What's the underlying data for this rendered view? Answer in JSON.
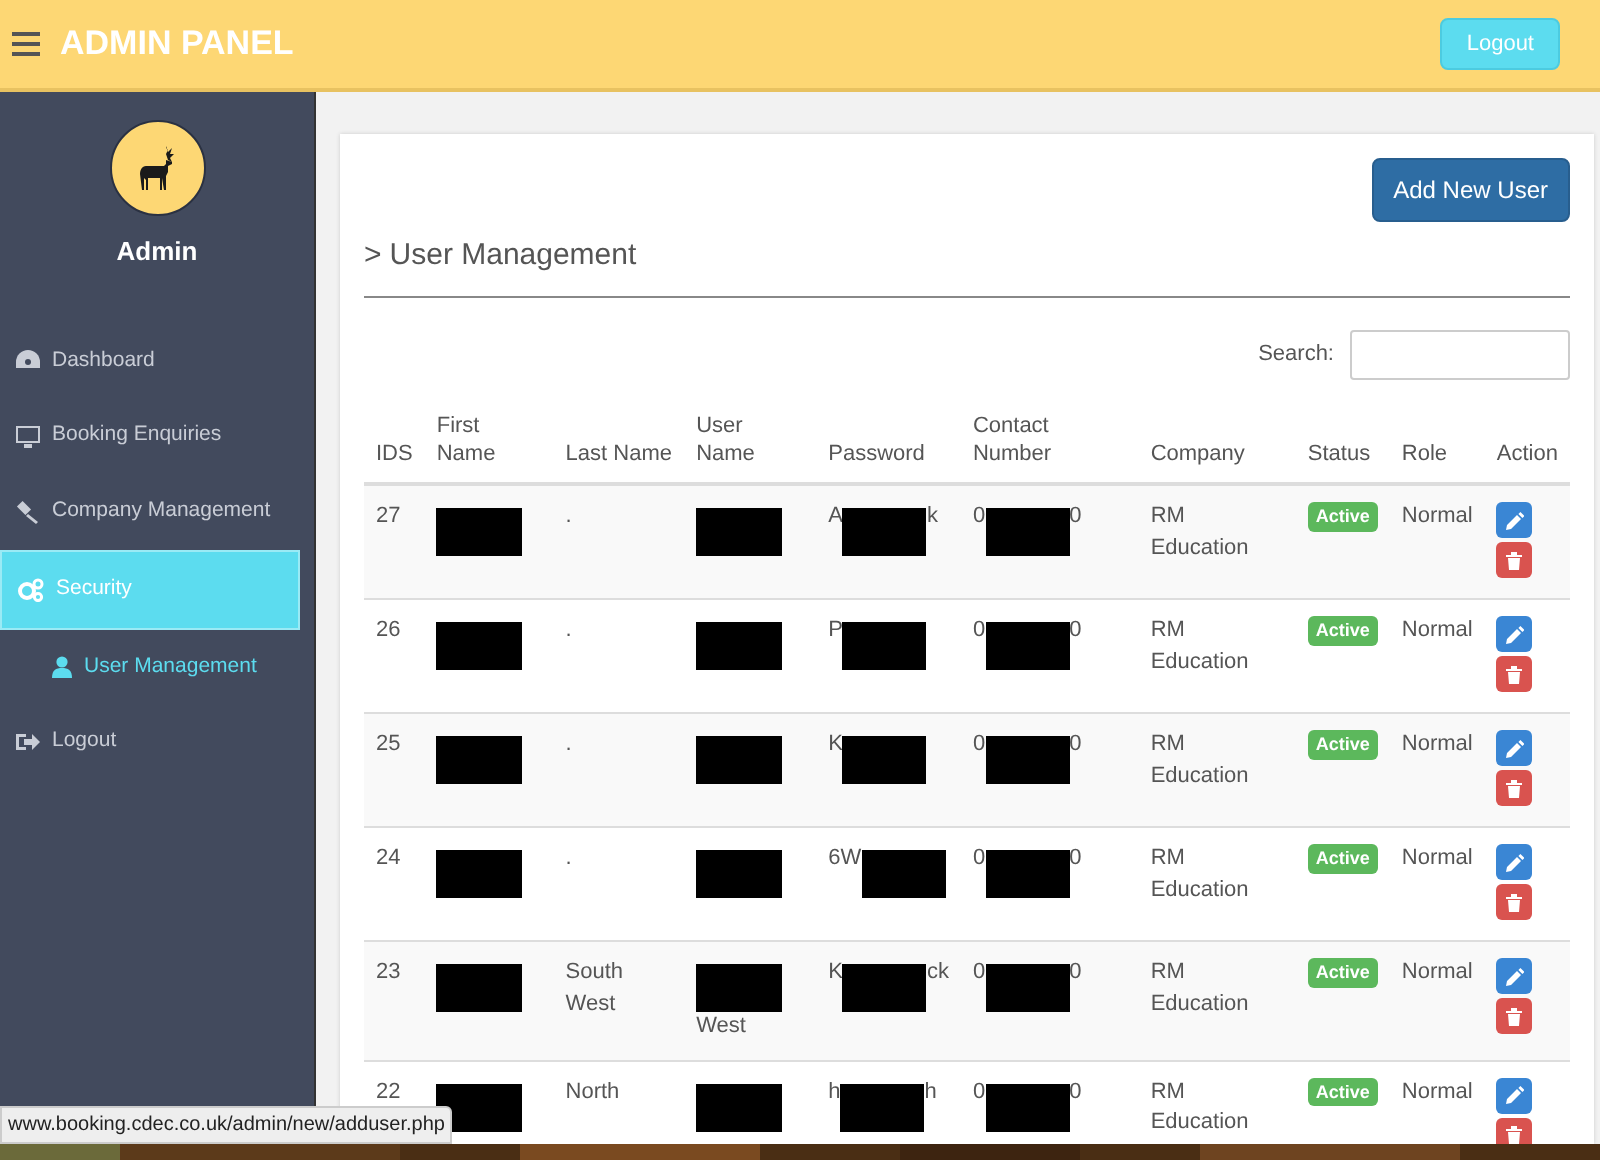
{
  "header": {
    "title": "ADMIN PANEL",
    "logout_button": "Logout"
  },
  "sidebar": {
    "user_name": "Admin",
    "items": [
      {
        "label": "Dashboard",
        "selected": false
      },
      {
        "label": "Booking Enquiries",
        "selected": false
      },
      {
        "label": "Company Management",
        "selected": false
      },
      {
        "label": "Security",
        "selected": true,
        "children": [
          {
            "label": "User Management",
            "selected": true
          }
        ]
      },
      {
        "label": "Logout",
        "selected": false
      }
    ]
  },
  "page": {
    "add_button": "Add New User",
    "title": "User Management",
    "breadcrumb_mark": ">",
    "search_label": "Search:"
  },
  "table": {
    "columns": [
      "IDS",
      "First Name",
      "Last Name",
      "User Name",
      "Password",
      "Contact Number",
      "Company",
      "Status",
      "Role",
      "Action"
    ],
    "rows": [
      {
        "id": "27",
        "first_name": {
          "redacted": true
        },
        "last_name": ".",
        "user_name": {
          "redacted": true
        },
        "password": {
          "redacted": true,
          "before": "A",
          "after": "k"
        },
        "contact": {
          "redacted": true,
          "before": "0",
          "after": "0"
        },
        "company": "RM Education",
        "status": "Active",
        "role": "Normal"
      },
      {
        "id": "26",
        "first_name": {
          "redacted": true
        },
        "last_name": ".",
        "user_name": {
          "redacted": true
        },
        "password": {
          "redacted": true,
          "before": "P"
        },
        "contact": {
          "redacted": true,
          "before": "0",
          "after": "0"
        },
        "company": "RM Education",
        "status": "Active",
        "role": "Normal"
      },
      {
        "id": "25",
        "first_name": {
          "redacted": true
        },
        "last_name": ".",
        "user_name": {
          "redacted": true
        },
        "password": {
          "redacted": true,
          "before": "K"
        },
        "contact": {
          "redacted": true,
          "before": "0",
          "after": "0"
        },
        "company": "RM Education",
        "status": "Active",
        "role": "Normal"
      },
      {
        "id": "24",
        "first_name": {
          "redacted": true
        },
        "last_name": ".",
        "user_name": {
          "redacted": true
        },
        "password": {
          "redacted": true,
          "before": "6W"
        },
        "contact": {
          "redacted": true,
          "before": "0",
          "after": "0"
        },
        "company": "RM Education",
        "status": "Active",
        "role": "Normal"
      },
      {
        "id": "23",
        "first_name": {
          "redacted": true
        },
        "last_name": "South West",
        "user_name": {
          "redacted": true,
          "below": "West"
        },
        "password": {
          "redacted": true,
          "before": "K",
          "after": "ck"
        },
        "contact": {
          "redacted": true,
          "before": "0",
          "after": "0"
        },
        "company": "RM Education",
        "status": "Active",
        "role": "Normal"
      },
      {
        "id": "22",
        "first_name": {
          "redacted": true
        },
        "last_name": "North",
        "user_name": {
          "redacted": true
        },
        "password": {
          "redacted": true,
          "before": "h",
          "after": "h"
        },
        "contact": {
          "redacted": true,
          "before": "0",
          "after": "0"
        },
        "company": "RM Education",
        "status": "Active",
        "role": "Normal"
      }
    ]
  },
  "status_bar": {
    "url": "www.booking.cdec.co.uk/admin/new/adduser.php"
  }
}
